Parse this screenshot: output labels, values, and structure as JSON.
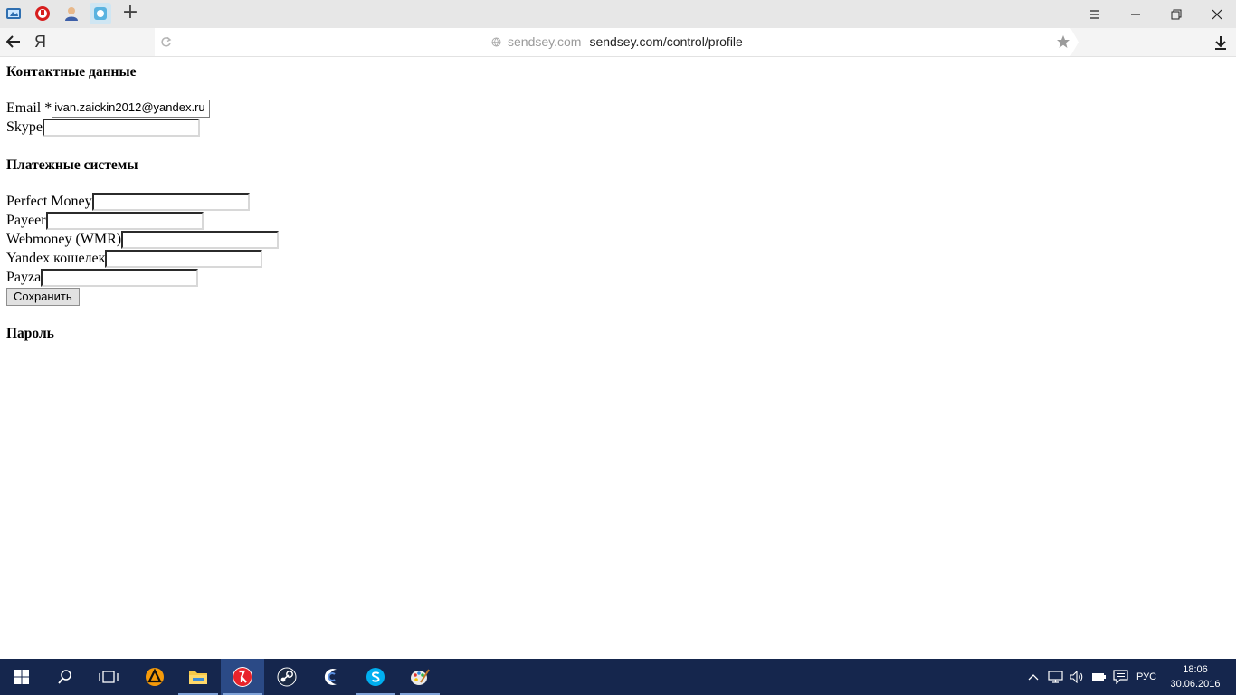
{
  "browser": {
    "url_domain": "sendsey.com",
    "url_path": "sendsey.com/control/profile",
    "back_label": "Я",
    "new_tab_label": "+"
  },
  "page": {
    "contacts_heading": "Контактные данные",
    "email_label": "Email *",
    "email_value": "ivan.zaickin2012@yandex.ru",
    "skype_label": "Skype",
    "skype_value": "",
    "payments_heading": "Платежные системы",
    "perfect_money_label": "Perfect Money",
    "perfect_money_value": "",
    "payeer_label": "Payeer",
    "payeer_value": "",
    "webmoney_label": "Webmoney (WMR)",
    "webmoney_value": "",
    "yandex_label": "Yandex кошелек",
    "yandex_value": "",
    "payza_label": "Payza",
    "payza_value": "",
    "save_label": "Сохранить",
    "password_heading": "Пароль"
  },
  "taskbar": {
    "apps": [
      "start-icon",
      "search-icon",
      "task-view-icon",
      "aimp-icon",
      "file-explorer-icon",
      "yandex-browser-icon",
      "steam-icon",
      "cloud-app-icon",
      "skype-icon",
      "paint-icon"
    ],
    "tray": [
      "chevron-up-icon",
      "network-icon",
      "volume-icon",
      "battery-icon",
      "notifications-icon"
    ],
    "language": "РУС",
    "time": "18:06",
    "date": "30.06.2016"
  },
  "colors": {
    "taskbar": "#15264d",
    "tabbar": "#e7e7e7",
    "active_tab": "#cfe6f3"
  }
}
